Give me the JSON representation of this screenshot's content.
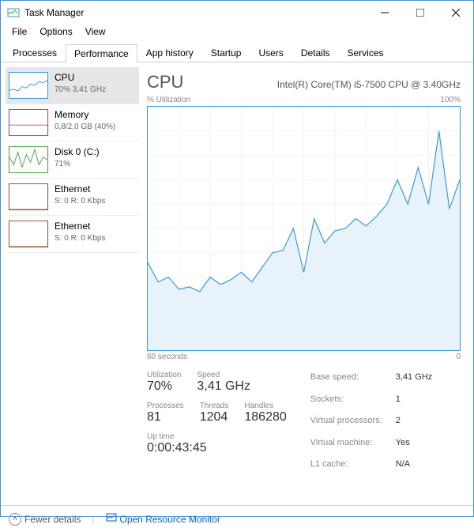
{
  "window": {
    "title": "Task Manager"
  },
  "menu": {
    "file": "File",
    "options": "Options",
    "view": "View"
  },
  "tabs": {
    "processes": "Processes",
    "performance": "Performance",
    "app_history": "App history",
    "startup": "Startup",
    "users": "Users",
    "details": "Details",
    "services": "Services"
  },
  "sidebar": {
    "items": [
      {
        "title": "CPU",
        "sub": "70% 3,41 GHz",
        "color": "cpu"
      },
      {
        "title": "Memory",
        "sub": "0,8/2,0 GB (40%)",
        "color": "mem"
      },
      {
        "title": "Disk 0 (C:)",
        "sub": "71%",
        "color": "disk"
      },
      {
        "title": "Ethernet",
        "sub": "S: 0  R: 0 Kbps",
        "color": "eth"
      },
      {
        "title": "Ethernet",
        "sub": "S: 0  R: 0 Kbps",
        "color": "eth"
      }
    ]
  },
  "main": {
    "title": "CPU",
    "subtitle": "Intel(R) Core(TM) i5-7500 CPU @ 3.40GHz",
    "ylabel": "% Utilization",
    "ymax": "100%",
    "xleft": "60 seconds",
    "xright": "0"
  },
  "stats": {
    "utilization_lbl": "Utilization",
    "utilization": "70%",
    "speed_lbl": "Speed",
    "speed": "3,41 GHz",
    "processes_lbl": "Processes",
    "processes": "81",
    "threads_lbl": "Threads",
    "threads": "1204",
    "handles_lbl": "Handles",
    "handles": "186280",
    "uptime_lbl": "Up time",
    "uptime": "0:00:43:45",
    "base_speed_lbl": "Base speed:",
    "base_speed": "3,41 GHz",
    "sockets_lbl": "Sockets:",
    "sockets": "1",
    "vproc_lbl": "Virtual processors:",
    "vproc": "2",
    "vmachine_lbl": "Virtual machine:",
    "vmachine": "Yes",
    "l1_lbl": "L1 cache:",
    "l1": "N/A"
  },
  "footer": {
    "fewer": "Fewer details",
    "resmon": "Open Resource Monitor"
  },
  "chart_data": {
    "type": "line",
    "title": "% Utilization",
    "xlabel": "seconds",
    "ylabel": "% Utilization",
    "xlim": [
      60,
      0
    ],
    "ylim": [
      0,
      100
    ],
    "x": [
      60,
      58,
      56,
      54,
      52,
      50,
      48,
      46,
      44,
      42,
      40,
      38,
      36,
      34,
      32,
      30,
      28,
      26,
      24,
      22,
      20,
      18,
      16,
      14,
      12,
      10,
      8,
      6,
      4,
      2,
      0
    ],
    "values": [
      36,
      28,
      30,
      25,
      26,
      24,
      30,
      27,
      29,
      32,
      28,
      34,
      40,
      41,
      50,
      32,
      54,
      44,
      49,
      50,
      54,
      51,
      55,
      60,
      70,
      60,
      75,
      60,
      90,
      58,
      70
    ],
    "grid": true
  },
  "mini_charts": {
    "cpu": [
      30,
      35,
      28,
      45,
      40,
      55,
      50,
      65,
      60,
      70
    ],
    "mem": [
      40,
      40,
      40,
      40,
      40,
      40,
      40,
      40,
      40,
      40
    ],
    "disk": [
      60,
      30,
      80,
      20,
      70,
      40,
      90,
      30,
      60,
      50
    ],
    "eth1": [
      0,
      0,
      0,
      0,
      0,
      0,
      0,
      0,
      0,
      0
    ],
    "eth2": [
      0,
      0,
      0,
      0,
      0,
      0,
      0,
      0,
      0,
      0
    ]
  }
}
